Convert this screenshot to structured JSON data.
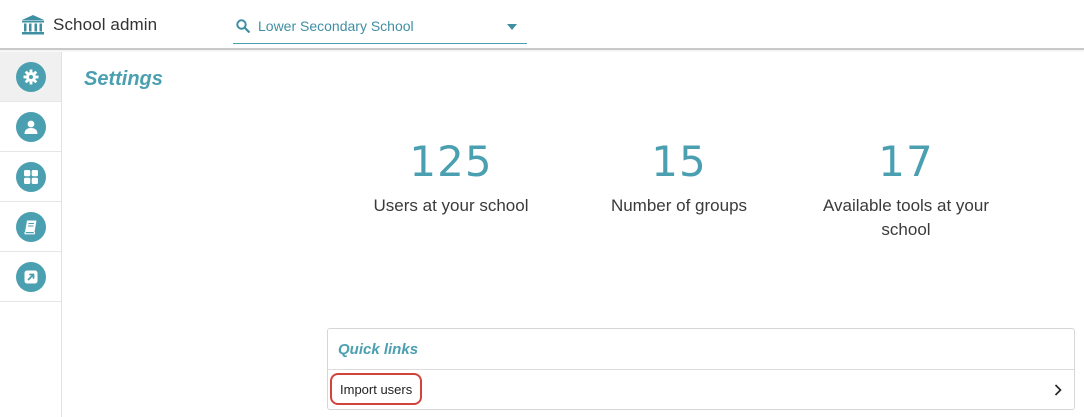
{
  "header": {
    "app_title": "School admin",
    "school_select": {
      "value": "Lower Secondary School"
    }
  },
  "sidebar": {
    "items": [
      {
        "id": "settings",
        "icon": "gear-icon",
        "active": true
      },
      {
        "id": "users",
        "icon": "user-icon",
        "active": false
      },
      {
        "id": "groups",
        "icon": "grid-icon",
        "active": false
      },
      {
        "id": "tools",
        "icon": "book-icon",
        "active": false
      },
      {
        "id": "external",
        "icon": "external-link-icon",
        "active": false
      }
    ]
  },
  "main": {
    "page_title": "Settings",
    "stats": [
      {
        "value": "125",
        "label": "Users at your school"
      },
      {
        "value": "15",
        "label": "Number of groups"
      },
      {
        "value": "17",
        "label": "Available tools at your school"
      }
    ],
    "quick_links": {
      "title": "Quick links",
      "items": [
        {
          "label": "Import users"
        }
      ]
    }
  },
  "colors": {
    "accent": "#4a9fb0",
    "highlight_outline": "#d0443c"
  }
}
